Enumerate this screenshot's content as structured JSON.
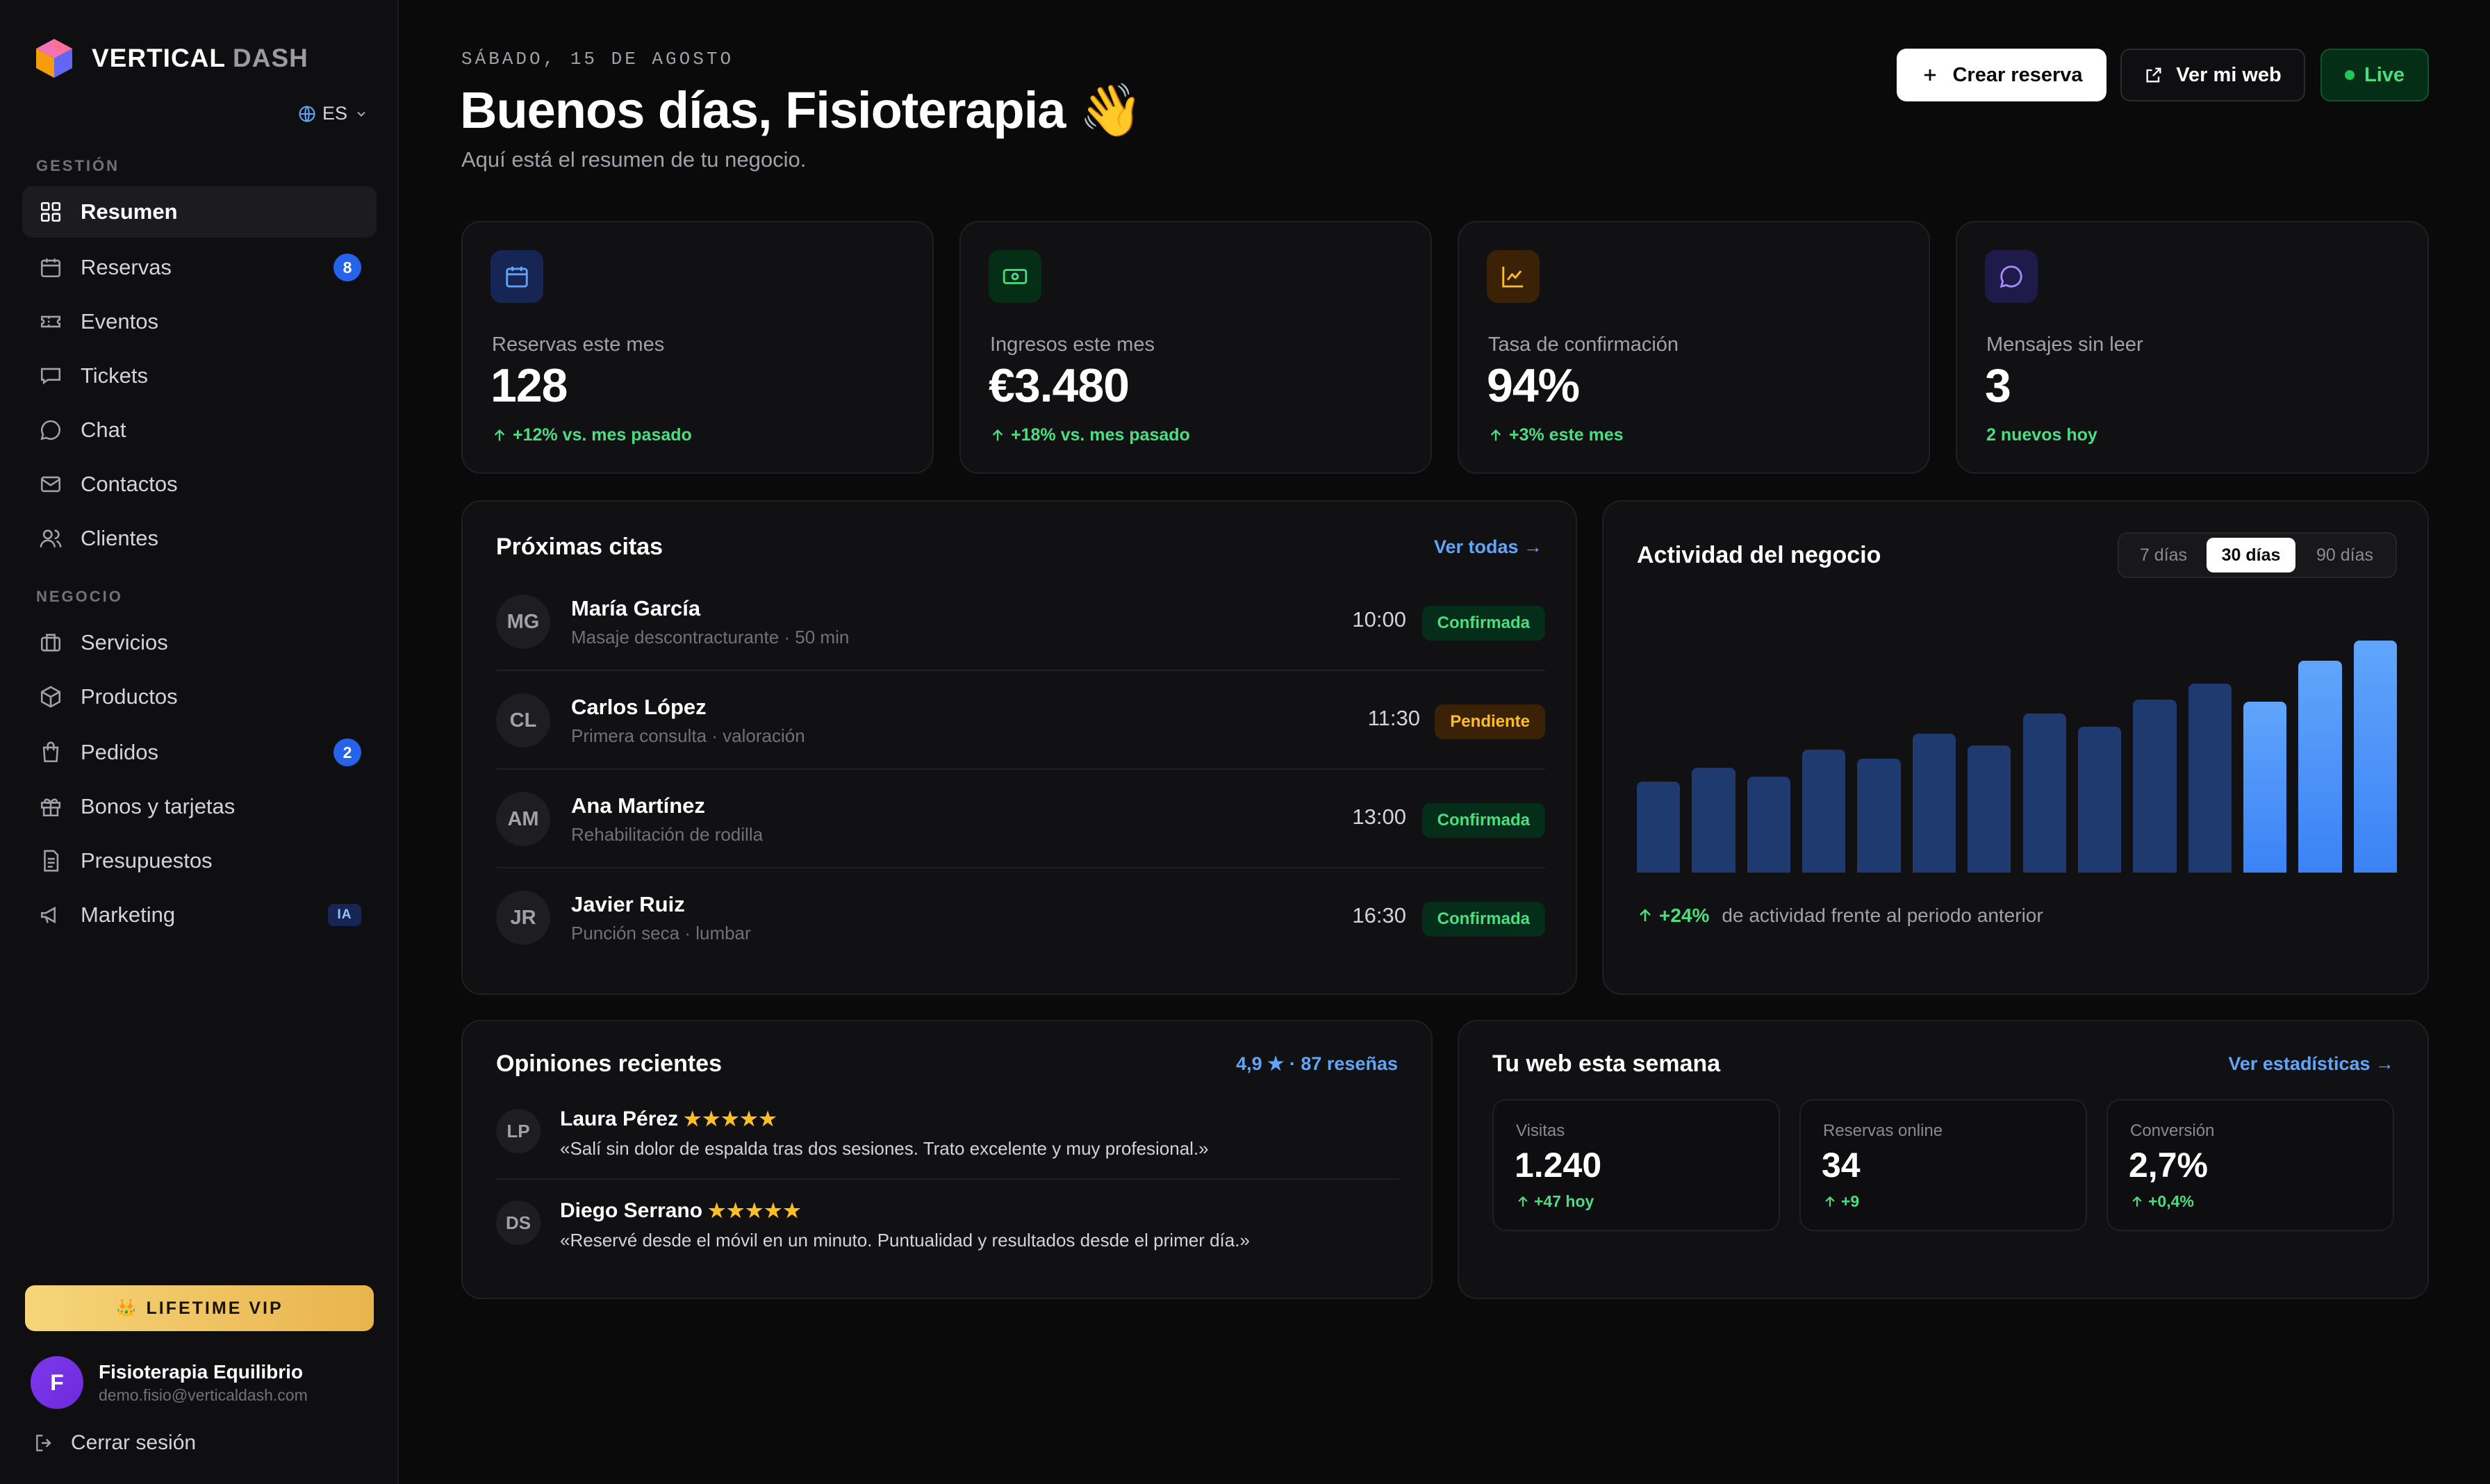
{
  "sidebar": {
    "brand_primary": "VERTICAL",
    "brand_secondary": "DASH",
    "language": "ES",
    "sections": {
      "gestion": "GESTIÓN",
      "negocio": "NEGOCIO"
    },
    "items": [
      {
        "label": "Resumen",
        "icon": "grid-icon",
        "active": true
      },
      {
        "label": "Reservas",
        "icon": "calendar-icon",
        "badge": "8"
      },
      {
        "label": "Eventos",
        "icon": "ticket-icon"
      },
      {
        "label": "Tickets",
        "icon": "message-square-icon"
      },
      {
        "label": "Chat",
        "icon": "chat-bubble-icon"
      },
      {
        "label": "Contactos",
        "icon": "mail-icon"
      },
      {
        "label": "Clientes",
        "icon": "users-icon"
      },
      {
        "label": "Servicios",
        "icon": "briefcase-icon"
      },
      {
        "label": "Productos",
        "icon": "box-icon"
      },
      {
        "label": "Pedidos",
        "icon": "shopping-bag-icon",
        "badge": "2"
      },
      {
        "label": "Bonos y tarjetas",
        "icon": "gift-icon"
      },
      {
        "label": "Presupuestos",
        "icon": "document-icon"
      },
      {
        "label": "Marketing",
        "icon": "megaphone-icon",
        "badge": "IA"
      }
    ],
    "vip_label": "LIFETIME VIP",
    "user": {
      "initial": "F",
      "name": "Fisioterapia Equilibrio",
      "email": "demo.fisio@verticaldash.com"
    },
    "logout_label": "Cerrar sesión"
  },
  "header": {
    "date": "SÁBADO, 15 DE AGOSTO",
    "greeting": "Buenos días, Fisioterapia 👋",
    "subtitle": "Aquí está el resumen de tu negocio.",
    "create_label": "Crear reserva",
    "view_web_label": "Ver mi web",
    "live_label": "Live"
  },
  "stats": [
    {
      "label": "Reservas este mes",
      "value": "128",
      "delta": "+12% vs. mes pasado",
      "icon": "calendar-icon",
      "color": "#60a5fa"
    },
    {
      "label": "Ingresos este mes",
      "value": "€3.480",
      "delta": "+18% vs. mes pasado",
      "icon": "cash-icon",
      "color": "#4ade80"
    },
    {
      "label": "Tasa de confirmación",
      "value": "94%",
      "delta": "+3% este mes",
      "icon": "trend-chart-icon",
      "color": "#fbbf24"
    },
    {
      "label": "Mensajes sin leer",
      "value": "3",
      "delta": "2 nuevos hoy",
      "icon": "chat-bubble-icon",
      "color": "#a78bfa"
    }
  ],
  "appointments": {
    "title": "Próximas citas",
    "link": "Ver todas →",
    "items": [
      {
        "initials": "MG",
        "name": "María García",
        "service": "Masaje descontracturante · 50 min",
        "time": "10:00",
        "status": "Confirmada"
      },
      {
        "initials": "CL",
        "name": "Carlos López",
        "service": "Primera consulta · valoración",
        "time": "11:30",
        "status": "Pendiente"
      },
      {
        "initials": "AM",
        "name": "Ana Martínez",
        "service": "Rehabilitación de rodilla",
        "time": "13:00",
        "status": "Confirmada"
      },
      {
        "initials": "JR",
        "name": "Javier Ruiz",
        "service": "Punción seca · lumbar",
        "time": "16:30",
        "status": "Confirmada"
      }
    ]
  },
  "activity": {
    "title": "Actividad del negocio",
    "ranges": [
      "7 días",
      "30 días",
      "90 días"
    ],
    "selected_range": "30 días",
    "delta": "+24%",
    "note": "de actividad frente al periodo anterior"
  },
  "chart_data": {
    "type": "bar",
    "title": "Actividad del negocio",
    "values": [
      40,
      46,
      42,
      54,
      50,
      61,
      56,
      70,
      64,
      76,
      83,
      75,
      93,
      102
    ],
    "ylim": [
      0,
      102
    ],
    "colors": {
      "base": "#1e3a6e",
      "highlight_start": "#3b82f6",
      "highlight_end": "#60a5fa"
    },
    "highlighted_last": 3
  },
  "reviews": {
    "title": "Opiniones recientes",
    "summary": "4,9 ★ · 87 reseñas",
    "items": [
      {
        "initials": "LP",
        "name": "Laura Pérez",
        "stars": "★★★★★",
        "text": "«Salí sin dolor de espalda tras dos sesiones. Trato excelente y muy profesional.»"
      },
      {
        "initials": "DS",
        "name": "Diego Serrano",
        "stars": "★★★★★",
        "text": "«Reservé desde el móvil en un minuto. Puntualidad y resultados desde el primer día.»"
      }
    ]
  },
  "web": {
    "title": "Tu web esta semana",
    "link": "Ver estadísticas →",
    "metrics": [
      {
        "label": "Visitas",
        "value": "1.240",
        "delta": "+47 hoy"
      },
      {
        "label": "Reservas online",
        "value": "34",
        "delta": "+9"
      },
      {
        "label": "Conversión",
        "value": "2,7%",
        "delta": "+0,4%"
      }
    ]
  }
}
